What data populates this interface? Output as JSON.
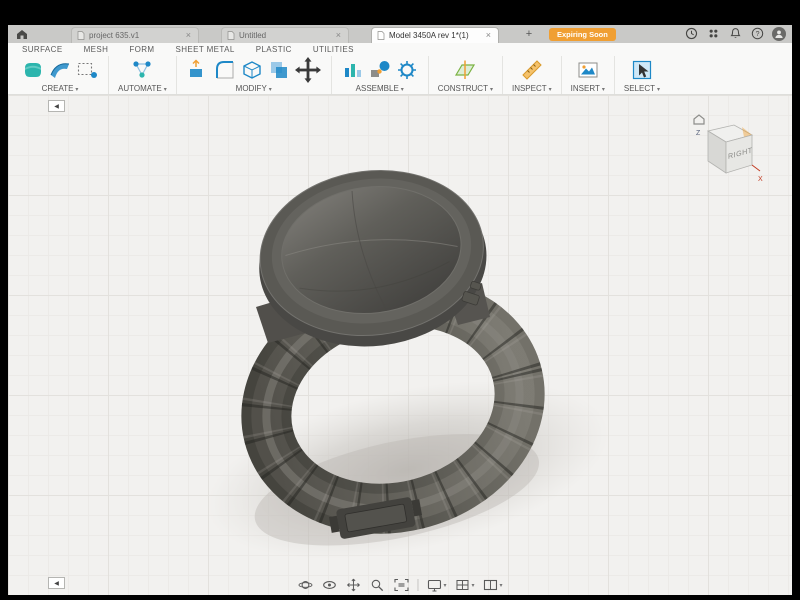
{
  "colors": {
    "badge_orange": "#f09f33",
    "accent_blue": "#1e88c7",
    "accent_teal": "#2cb5ad",
    "axis_x_red": "#c23b22",
    "canvas_background": "#f2f1ef"
  },
  "header": {
    "tabs": [
      {
        "label": "project 635.v1"
      },
      {
        "label": "Untitled"
      },
      {
        "label": "Model 3450A rev 1*(1)"
      }
    ],
    "active_tab_index": 2,
    "close_glyph": "×",
    "new_tab_glyph": "+",
    "badge_label": "Expiring Soon"
  },
  "menubar": {
    "items": [
      "SURFACE",
      "MESH",
      "FORM",
      "SHEET METAL",
      "PLASTIC",
      "UTILITIES"
    ]
  },
  "toolbar": {
    "caret": "▾",
    "groups": [
      {
        "label": "CREATE"
      },
      {
        "label": "AUTOMATE"
      },
      {
        "label": "MODIFY"
      },
      {
        "label": "ASSEMBLE"
      },
      {
        "label": "CONSTRUCT"
      },
      {
        "label": "INSPECT"
      },
      {
        "label": "INSERT"
      },
      {
        "label": "SELECT"
      }
    ]
  },
  "viewcube": {
    "face_label": "RIGHT",
    "axis_z_label": "Z",
    "axis_x_label": "X"
  },
  "panels": {
    "toggle_glyph": "◀"
  },
  "navbar": {
    "caret": "▾"
  }
}
